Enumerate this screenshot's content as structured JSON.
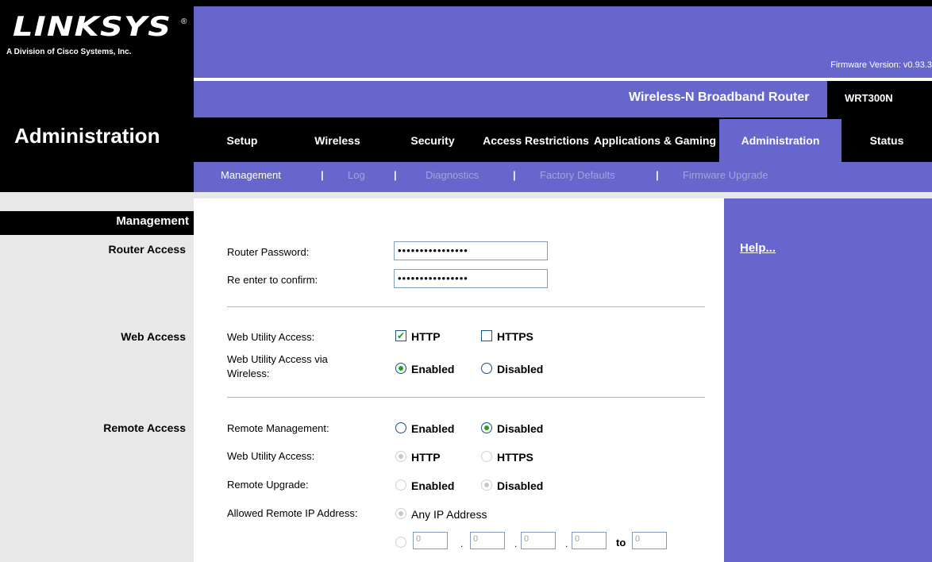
{
  "header": {
    "logo_text": "LINKSYS",
    "logo_reg": "®",
    "logo_subtitle": "A Division of Cisco Systems, Inc.",
    "firmware_version": "Firmware Version: v0.93.3",
    "product_name": "Wireless-N Broadband Router",
    "model": "WRT300N"
  },
  "page_title": "Administration",
  "tabs": [
    {
      "label": "Setup"
    },
    {
      "label": "Wireless"
    },
    {
      "label": "Security"
    },
    {
      "label": "Access Restrictions"
    },
    {
      "label": "Applications & Gaming"
    },
    {
      "label": "Administration"
    },
    {
      "label": "Status"
    }
  ],
  "subnav": [
    {
      "label": "Management"
    },
    {
      "label": "Log"
    },
    {
      "label": "Diagnostics"
    },
    {
      "label": "Factory Defaults"
    },
    {
      "label": "Firmware Upgrade"
    }
  ],
  "subnav_separator": "|",
  "sidebar": {
    "section_title": "Management",
    "router_access": "Router Access",
    "web_access": "Web Access",
    "remote_access": "Remote Access"
  },
  "router_access": {
    "password_label": "Router Password:",
    "password_value": "••••••••••••••••",
    "confirm_label": "Re enter to  confirm:",
    "confirm_value": "••••••••••••••••"
  },
  "web_access": {
    "utility_label": "Web Utility Access:",
    "http_label": "HTTP",
    "http_checked": true,
    "https_label": "HTTPS",
    "https_checked": false,
    "wireless_label_1": "Web Utility Access via",
    "wireless_label_2": "Wireless:",
    "enabled_label": "Enabled",
    "disabled_label": "Disabled",
    "wireless_selected": "Enabled"
  },
  "remote_access": {
    "mgmt_label": "Remote  Management:",
    "mgmt_enabled": "Enabled",
    "mgmt_disabled": "Disabled",
    "mgmt_selected": "Disabled",
    "utility_label": "Web Utility Access:",
    "http_label": "HTTP",
    "https_label": "HTTPS",
    "upgrade_label": "Remote Upgrade:",
    "upgrade_enabled": "Enabled",
    "upgrade_disabled": "Disabled",
    "allowed_ip_label": "Allowed Remote IP Address:",
    "any_ip_label": "Any IP Address",
    "ip_from": [
      "0",
      "0",
      "0",
      "0"
    ],
    "ip_sep": ".",
    "to_label": "to",
    "ip_to": "0"
  },
  "help_link": "Help...",
  "colors": {
    "brand_purple": "#6666cc",
    "black": "#000000",
    "check_green": "#21a121"
  }
}
